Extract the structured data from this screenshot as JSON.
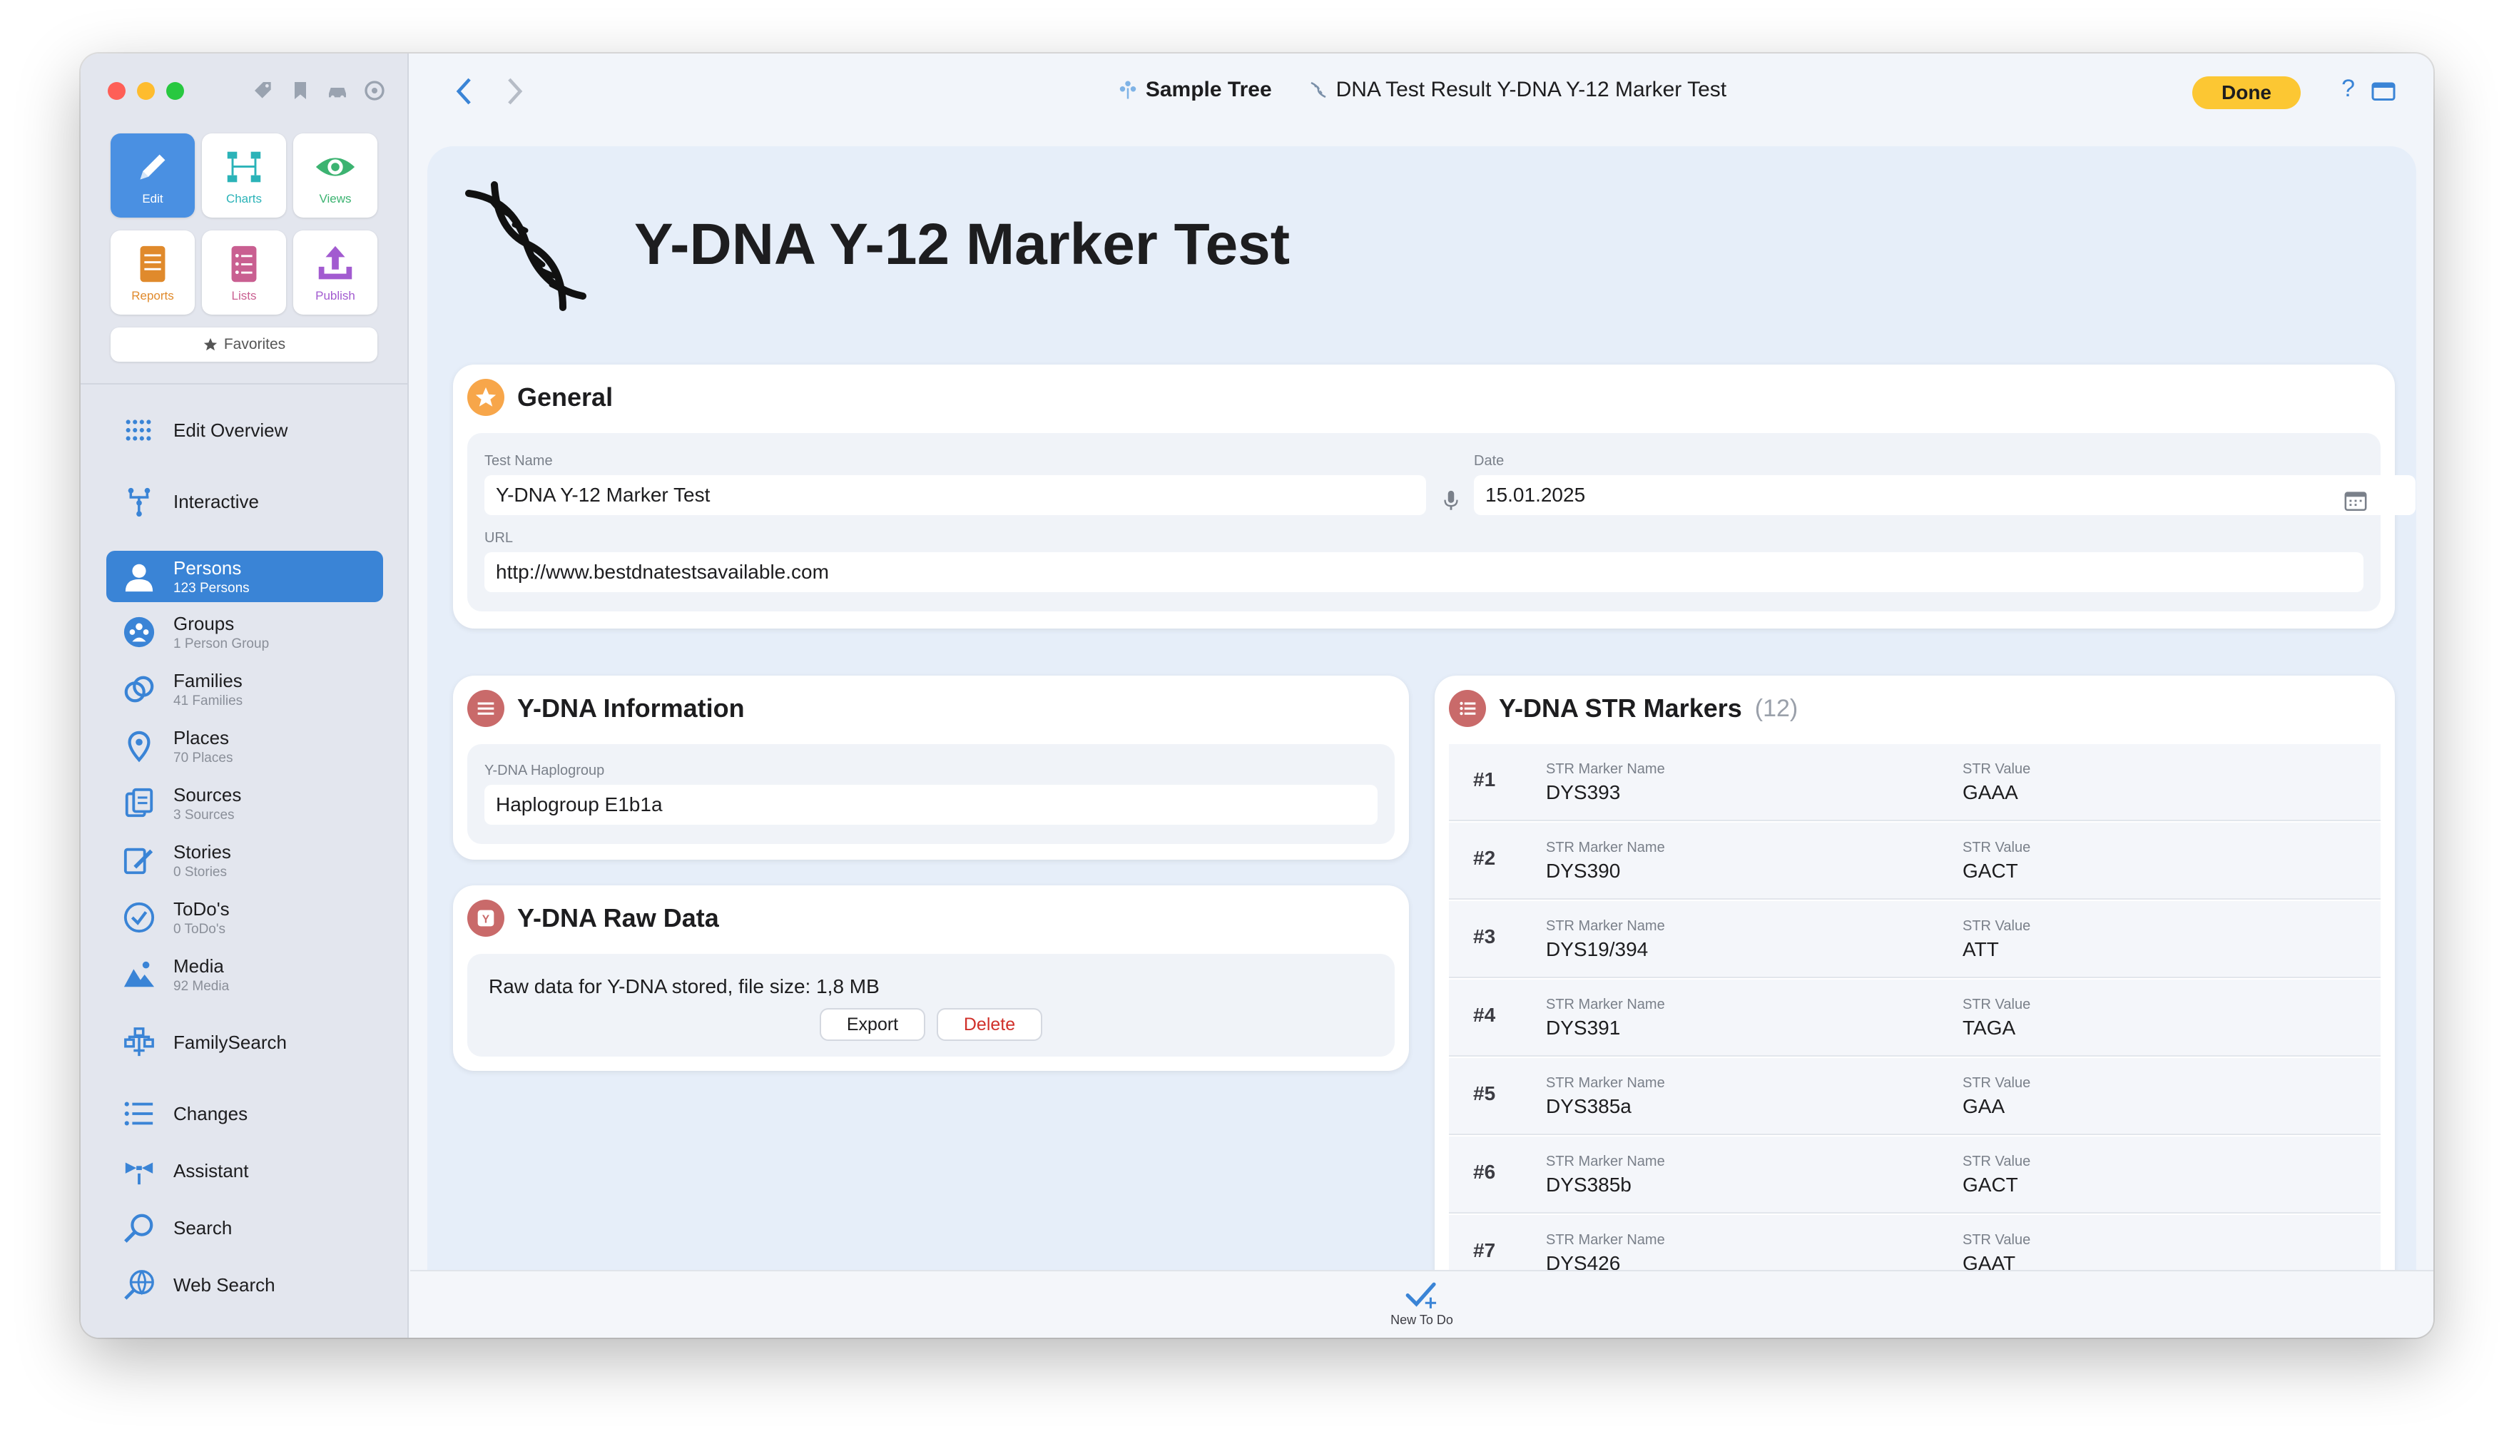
{
  "app": {
    "colors": {
      "accent": "#3a84d6",
      "done": "#fcc733",
      "edit_tile": "#4a90e2"
    }
  },
  "toolbar": {
    "tiles": [
      {
        "label": "Edit",
        "icon": "pencil-icon",
        "color": "#ffffff"
      },
      {
        "label": "Charts",
        "icon": "charts-icon",
        "color": "#2bb3b8"
      },
      {
        "label": "Views",
        "icon": "eye-icon",
        "color": "#3cb371"
      },
      {
        "label": "Reports",
        "icon": "report-icon",
        "color": "#e08a2c"
      },
      {
        "label": "Lists",
        "icon": "list-icon",
        "color": "#c95f91"
      },
      {
        "label": "Publish",
        "icon": "publish-icon",
        "color": "#a25bd0"
      }
    ],
    "favorites_label": "Favorites"
  },
  "sidebar": {
    "items": [
      {
        "label": "Edit Overview",
        "icon": "grid-icon"
      },
      {
        "label": "Interactive",
        "icon": "tree-icon"
      },
      {
        "label": "Persons",
        "sub": "123 Persons",
        "icon": "person-icon",
        "active": true
      },
      {
        "label": "Groups",
        "sub": "1 Person Group",
        "icon": "group-icon"
      },
      {
        "label": "Families",
        "sub": "41 Families",
        "icon": "rings-icon"
      },
      {
        "label": "Places",
        "sub": "70 Places",
        "icon": "pin-icon"
      },
      {
        "label": "Sources",
        "sub": "3 Sources",
        "icon": "sources-icon"
      },
      {
        "label": "Stories",
        "sub": "0 Stories",
        "icon": "stories-icon"
      },
      {
        "label": "ToDo's",
        "sub": "0 ToDo's",
        "icon": "check-circle-icon"
      },
      {
        "label": "Media",
        "sub": "92 Media",
        "icon": "media-icon"
      },
      {
        "label": "FamilySearch",
        "icon": "familysearch-icon"
      },
      {
        "label": "Changes",
        "icon": "changes-icon"
      },
      {
        "label": "Assistant",
        "icon": "assistant-icon"
      },
      {
        "label": "Search",
        "icon": "search-icon"
      },
      {
        "label": "Web Search",
        "icon": "web-search-icon"
      }
    ]
  },
  "header": {
    "tree_name": "Sample Tree",
    "record_title": "DNA Test Result Y-DNA Y-12 Marker Test",
    "done_label": "Done",
    "help_label": "?"
  },
  "page": {
    "title": "Y-DNA Y-12 Marker Test"
  },
  "general": {
    "title": "General",
    "test_name_label": "Test Name",
    "test_name_value": "Y-DNA Y-12 Marker Test",
    "date_label": "Date",
    "date_value": "15.01.2025",
    "url_label": "URL",
    "url_value": "http://www.bestdnatestsavailable.com"
  },
  "ydna_info": {
    "title": "Y-DNA Information",
    "haplogroup_label": "Y-DNA Haplogroup",
    "haplogroup_value": "Haplogroup E1b1a"
  },
  "raw_data": {
    "title": "Y-DNA Raw Data",
    "badge": "Y",
    "text": "Raw data for Y-DNA stored, file size: 1,8 MB",
    "export_label": "Export",
    "delete_label": "Delete"
  },
  "str_markers": {
    "title": "Y-DNA STR Markers",
    "count": "(12)",
    "name_label": "STR Marker Name",
    "value_label": "STR Value",
    "rows": [
      {
        "num": "#1",
        "name": "DYS393",
        "value": "GAAA"
      },
      {
        "num": "#2",
        "name": "DYS390",
        "value": "GACT"
      },
      {
        "num": "#3",
        "name": "DYS19/394",
        "value": "ATT"
      },
      {
        "num": "#4",
        "name": "DYS391",
        "value": "TAGA"
      },
      {
        "num": "#5",
        "name": "DYS385a",
        "value": "GAA"
      },
      {
        "num": "#6",
        "name": "DYS385b",
        "value": "GACT"
      },
      {
        "num": "#7",
        "name": "DYS426",
        "value": "GAAT"
      }
    ]
  },
  "bottom": {
    "new_todo_label": "New To Do"
  }
}
